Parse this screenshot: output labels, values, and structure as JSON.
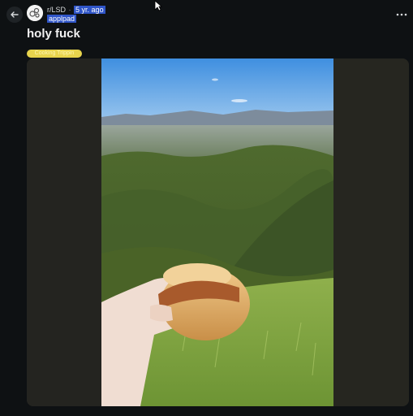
{
  "post": {
    "subreddit": "r/LSD",
    "separator": "·",
    "age": "5 yr. ago",
    "username": "applpad",
    "title": "holy fuck",
    "flair": "Cooking Trippin"
  },
  "icons": {
    "back": "arrow-left-icon",
    "more": "more-horizontal-icon",
    "avatar": "subreddit-avatar-icon",
    "cursor": "mouse-pointer-icon"
  },
  "colors": {
    "background": "#0e1113",
    "flair": "#e8d44d",
    "highlight": "#2f55c8"
  }
}
